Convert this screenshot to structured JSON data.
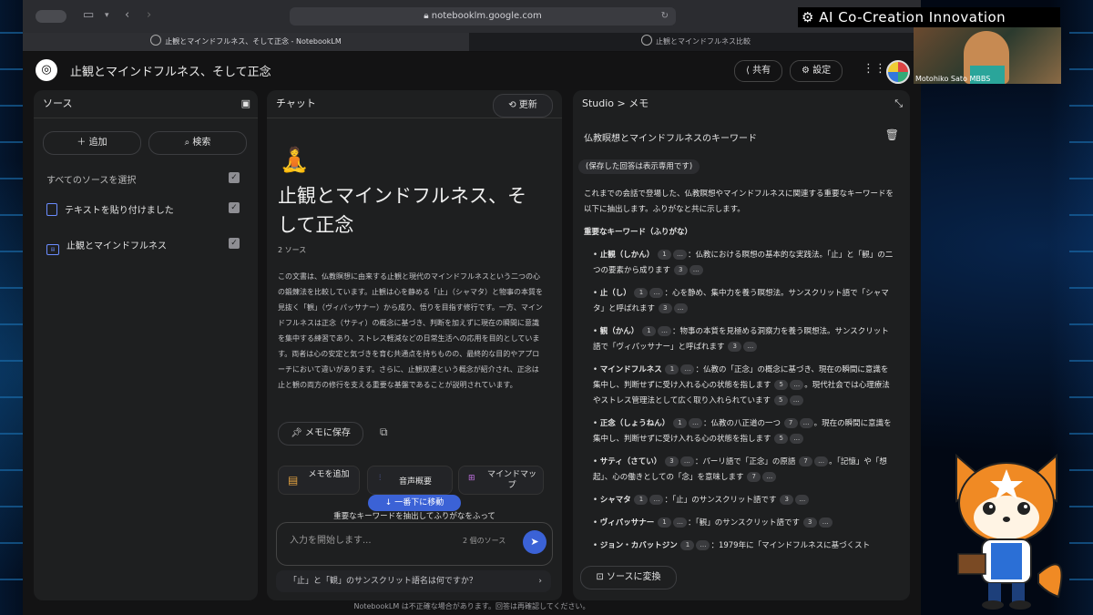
{
  "browser": {
    "url": "notebooklm.google.com",
    "tabs": [
      {
        "label": "止観とマインドフルネス、そして正念 - NotebookLM"
      },
      {
        "label": "止観とマインドフルネス比較"
      }
    ]
  },
  "header": {
    "title": "止観とマインドフルネス、そして正念",
    "share_label": "共有",
    "settings_label": "設定"
  },
  "sources": {
    "title": "ソース",
    "add_label": "追加",
    "search_label": "検索",
    "select_all_label": "すべてのソースを選択",
    "items": [
      {
        "label": "テキストを貼り付けました"
      },
      {
        "label": "止観とマインドフルネス"
      }
    ]
  },
  "chat": {
    "title": "チャット",
    "refresh_label": "更新",
    "emoji": "🧘",
    "notebook_title": "止観とマインドフルネス、そして正念",
    "source_count": "2 ソース",
    "summary": "この文書は、仏教瞑想に由来する止観と現代のマインドフルネスという二つの心の鍛錬法を比較しています。止観は心を静める「止」（シャマタ）と物事の本質を見抜く「観」（ヴィパッサナー）から成り、悟りを目指す修行です。一方、マインドフルネスは正念（サティ）の概念に基づき、判断を加えずに現在の瞬間に意識を集中する練習であり、ストレス軽減などの日常生活への応用を目的としています。両者は心の安定と気づきを育む共通点を持ちものの、最終的な目的やアプローチにおいて違いがあります。さらに、止観双運という概念が紹介され、正念は止と観の両方の修行を支える重要な基盤であることが説明されています。",
    "save_note_label": "メモに保存",
    "add_note_label": "メモを追加",
    "audio_label": "音声概要",
    "mindmap_label": "マインドマップ",
    "scroll_label": "一番下に移動",
    "partial_text": "重要なキーワードを抽出してふりがなをふって",
    "input_placeholder": "入力を開始します...",
    "input_source_count": "2 個のソース",
    "suggestion": "「止」と「観」のサンスクリット語名は何ですか？"
  },
  "studio": {
    "breadcrumb": "Studio > メモ",
    "note_title": "仏教瞑想とマインドフルネスのキーワード",
    "readonly_badge": "(保存した回答は表示専用です)",
    "intro": "これまでの会話で登場した、仏教瞑想やマインドフルネスに関連する重要なキーワードを以下に抽出します。ふりがなと共に示します。",
    "section_heading": "重要なキーワード（ふりがな）",
    "keywords": [
      {
        "term": "止観（しかん）",
        "c1": "1",
        "desc": "：仏教における瞑想の基本的な実践法。「止」と「観」の二つの要素から成ります",
        "c2": "3"
      },
      {
        "term": "止（し）",
        "c1": "1",
        "desc": "：心を静め、集中力を養う瞑想法。サンスクリット語で「シャマタ」と呼ばれます",
        "c2": "3"
      },
      {
        "term": "観（かん）",
        "c1": "1",
        "desc": "：物事の本質を見極める洞察力を養う瞑想法。サンスクリット語で「ヴィパッサナー」と呼ばれます",
        "c2": "3"
      },
      {
        "term": "マインドフルネス",
        "c1": "1",
        "desc": "：仏教の「正念」の概念に基づき、現在の瞬間に意識を集中し、判断せずに受け入れる心の状態を指します",
        "c2": "5",
        "extra": "。現代社会では心理療法やストレス管理法として広く取り入れられています",
        "c3": "5"
      },
      {
        "term": "正念（しょうねん）",
        "c1": "1",
        "desc": "：仏教の八正道の一つ",
        "c2": "7",
        "extra": "。現在の瞬間に意識を集中し、判断せずに受け入れる心の状態を指します",
        "c3": "5"
      },
      {
        "term": "サティ（さてい）",
        "c1": "3",
        "desc": "：パーリ語で「正念」の原語",
        "c2": "7",
        "extra": "。「記憶」や「想起」、心の働きとしての「念」を意味します",
        "c3": "7"
      },
      {
        "term": "シャマタ",
        "c1": "1",
        "desc": "：「止」のサンスクリット語です",
        "c2": "3"
      },
      {
        "term": "ヴィパッサナー",
        "c1": "1",
        "desc": "：「観」のサンスクリット語です",
        "c2": "3"
      },
      {
        "term": "ジョン・カバットジン",
        "c1": "1",
        "desc": "：1979年に「マインドフルネスに基づくスト",
        "c2": ""
      }
    ],
    "convert_label": "ソースに変換"
  },
  "footer_text": "NotebookLM は不正確な場合があります。回答は再確認してください。",
  "overlay": {
    "brand": "AI Co-Creation Innovation",
    "presenter": "Motohiko Sato MBBS"
  },
  "colors": {
    "accent": "#3b62d6",
    "panel": "#1e1f20",
    "background": "#131314"
  }
}
